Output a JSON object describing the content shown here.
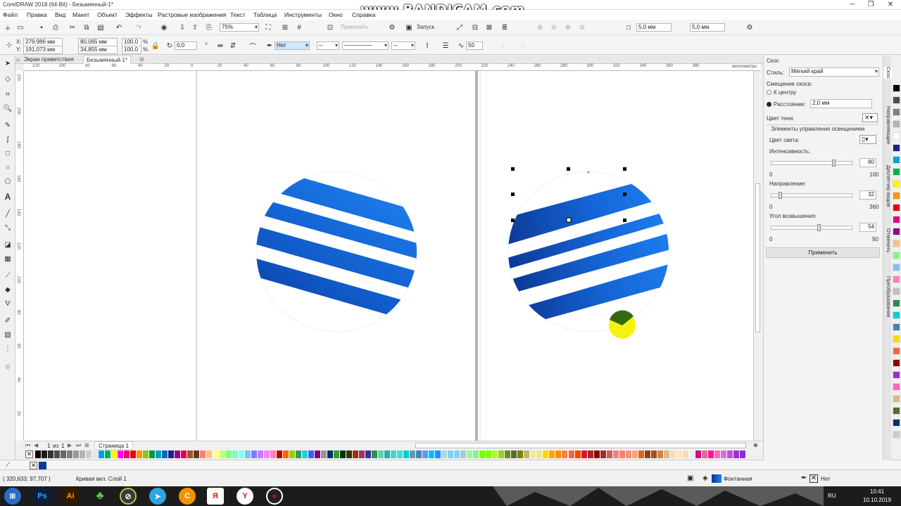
{
  "window": {
    "title": "CorelDRAW 2018 (64-Bit) - Безымянный-1*",
    "minimize": "─",
    "maximize": "❐",
    "close": "✕"
  },
  "watermark": "www.BANDICAM.com",
  "menu": [
    "Файл",
    "Правка",
    "Вид",
    "Макет",
    "Объект",
    "Эффекты",
    "Растровые изображения",
    "Текст",
    "Таблица",
    "Инструменты",
    "Окно",
    "Справка"
  ],
  "toolbar": {
    "zoom": "75%",
    "snap": "Привязать",
    "launch": "Запуск",
    "nudge1": "5,0 мм",
    "nudge2": "5,0 мм"
  },
  "propbar": {
    "x": "279,986 мм",
    "y": "191,073 мм",
    "w": "80,065 мм",
    "h": "34,855 мм",
    "sx": "100,0",
    "sy": "100,0",
    "pct": "%",
    "angle": "0,0",
    "outline": "Нет",
    "smooth": "50"
  },
  "tabs": {
    "welcome": "Экран приветствия",
    "doc": "Безымянный-1*"
  },
  "ruler": {
    "unit": "миллиметры",
    "h_ticks": [
      "120",
      "100",
      "80",
      "60",
      "40",
      "20",
      "0",
      "20",
      "40",
      "60",
      "80",
      "100",
      "120",
      "140",
      "160",
      "180",
      "200",
      "220",
      "240",
      "260",
      "280",
      "300",
      "320",
      "340",
      "360",
      "380"
    ],
    "v_ticks": [
      "220",
      "200",
      "180",
      "160",
      "140",
      "120",
      "100",
      "80",
      "60",
      "40",
      "20"
    ]
  },
  "pages": {
    "counter": "1",
    "of": "из",
    "total": "1",
    "page_tab": "Страница 1"
  },
  "docker": {
    "title": "Скос",
    "style_label": "Стиль:",
    "style_value": "Мягкий край",
    "offset_label": "Смещение скоса:",
    "to_center": "К центру",
    "distance_label": "Расстояние:",
    "distance_value": "2,0 мм",
    "shadow_color_label": "Цвет тени:",
    "lighting_label": "Элементы управления освещением",
    "light_color_label": "Цвет света:",
    "intensity_label": "Интенсивность:",
    "intensity_value": "80",
    "intensity_min": "0",
    "intensity_max": "100",
    "direction_label": "Направление:",
    "direction_value": "32",
    "direction_min": "0",
    "direction_max": "360",
    "elevation_label": "Угол возвышения:",
    "elevation_value": "54",
    "elevation_min": "0",
    "elevation_max": "90",
    "apply": "Применить"
  },
  "intensity_level": 0.8,
  "direction_level": 0.0889,
  "elevation_level": 0.6,
  "side_tabs": [
    "Скос",
    "Направляющие",
    "Диспетчер видов",
    "Отменить",
    "Преобразования"
  ],
  "status": {
    "coords": "( 320,633; 97,707 )",
    "object": "Кривая вкл. Слой 1",
    "fill": "Фонтанная",
    "outline": "Нет"
  },
  "clock": {
    "lang": "RU",
    "time": "10:41",
    "date": "10.10.2019"
  },
  "taskbar": [
    {
      "name": "start",
      "label": ""
    },
    {
      "name": "photoshop",
      "label": "Ps"
    },
    {
      "name": "illustrator",
      "label": "Ai"
    },
    {
      "name": "clover",
      "label": "♣"
    },
    {
      "name": "coreldraw",
      "label": "⊘"
    },
    {
      "name": "telegram",
      "label": "➤"
    },
    {
      "name": "ccleaner",
      "label": "C"
    },
    {
      "name": "yandex",
      "label": "Я"
    },
    {
      "name": "yandex-browser",
      "label": "Y"
    },
    {
      "name": "bandicam",
      "label": "●"
    }
  ],
  "palette": [
    "#000000",
    "#1a1a1a",
    "#333333",
    "#4d4d4d",
    "#666666",
    "#808080",
    "#999999",
    "#b3b3b3",
    "#cccccc",
    "#e6e6e6",
    "#00a0e9",
    "#00b050",
    "#fff200",
    "#ff00ff",
    "#e4007f",
    "#e60012",
    "#f39800",
    "#8fc31f",
    "#009944",
    "#00a0c1",
    "#0068b7",
    "#1d2088",
    "#920783",
    "#e5004f",
    "#a0522d",
    "#5f3c23",
    "#ff7f7f",
    "#ffbf7f",
    "#ffff7f",
    "#bfff7f",
    "#7fff7f",
    "#7fffbf",
    "#7fffff",
    "#7fbfff",
    "#7f7fff",
    "#bf7fff",
    "#ff7fff",
    "#ff7fbf",
    "#c00000",
    "#ff6600",
    "#99cc00",
    "#339966",
    "#33cccc",
    "#3366ff",
    "#800080",
    "#969696",
    "#003366",
    "#339933",
    "#003300",
    "#333300",
    "#993300",
    "#993366",
    "#333399",
    "#2e8b57",
    "#66cdaa",
    "#20b2aa",
    "#48d1cc",
    "#40e0d0",
    "#00ced1",
    "#5f9ea0",
    "#4682b4",
    "#6495ed",
    "#00bfff",
    "#1e90ff",
    "#add8e6",
    "#87ceeb",
    "#87cefa",
    "#b0c4de",
    "#98fb98",
    "#90ee90",
    "#7cfc00",
    "#7fff00",
    "#adff2f",
    "#9acd32",
    "#6b8e23",
    "#556b2f",
    "#808000",
    "#bdb76b",
    "#eee8aa",
    "#f0e68c",
    "#ffd700",
    "#ffa500",
    "#ff8c00",
    "#ff7f50",
    "#ff6347",
    "#ff4500",
    "#dc143c",
    "#b22222",
    "#8b0000",
    "#a52a2a",
    "#cd5c5c",
    "#f08080",
    "#fa8072",
    "#e9967a",
    "#ffa07a",
    "#d2691e",
    "#8b4513",
    "#a0522d",
    "#cd853f",
    "#deb887",
    "#f5deb3",
    "#ffe4b5",
    "#ffdab9",
    "#eee",
    "#c71585",
    "#db7093",
    "#ff1493",
    "#ff69b4",
    "#da70d6",
    "#ba55d3",
    "#9932cc",
    "#8a2be2"
  ],
  "right_palette": [
    "#000000",
    "#4d4d4d",
    "#808080",
    "#b3b3b3",
    "#ffffff",
    "#1d2088",
    "#00a0e9",
    "#00b050",
    "#fff200",
    "#f39800",
    "#e60012",
    "#e4007f",
    "#920783",
    "#ffbf7f",
    "#7fff7f",
    "#7fbfff",
    "#ff7fbf",
    "#c0c0c0",
    "#2e8b57",
    "#00ced1",
    "#4682b4",
    "#ffd700",
    "#ff6347",
    "#8b0000",
    "#9932cc",
    "#ff69b4",
    "#deb887",
    "#556b2f",
    "#003366",
    "#cccccc"
  ]
}
